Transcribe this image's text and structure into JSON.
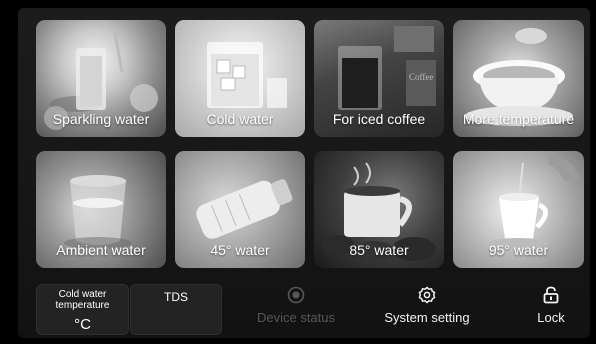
{
  "tiles": [
    {
      "label": "Sparkling water",
      "photo": "sparkling-water-glass"
    },
    {
      "label": "Cold water",
      "photo": "ice-water-glass"
    },
    {
      "label": "For iced coffee",
      "photo": "iced-coffee-glass"
    },
    {
      "label": "More temperature",
      "photo": "tea-cup"
    },
    {
      "label": "Ambient water",
      "photo": "water-glass"
    },
    {
      "label": "45° water",
      "photo": "baby-bottle"
    },
    {
      "label": "85° water",
      "photo": "coffee-mug-beans"
    },
    {
      "label": "95° water",
      "photo": "pouring-cup"
    }
  ],
  "status": {
    "cold_water_title": "Cold water temperature",
    "cold_water_value": "°C",
    "tds_title": "TDS",
    "tds_value": ""
  },
  "actions": {
    "device_status": "Device status",
    "system_setting": "System setting",
    "lock": "Lock"
  },
  "icons": {
    "device_status": "target-icon",
    "system_setting": "gear-icon",
    "lock": "lock-icon"
  },
  "colors": {
    "background": "#000000",
    "panel": "#1a1a1a",
    "card": "#232323",
    "text": "#ffffff",
    "disabled_text": "#575757"
  }
}
